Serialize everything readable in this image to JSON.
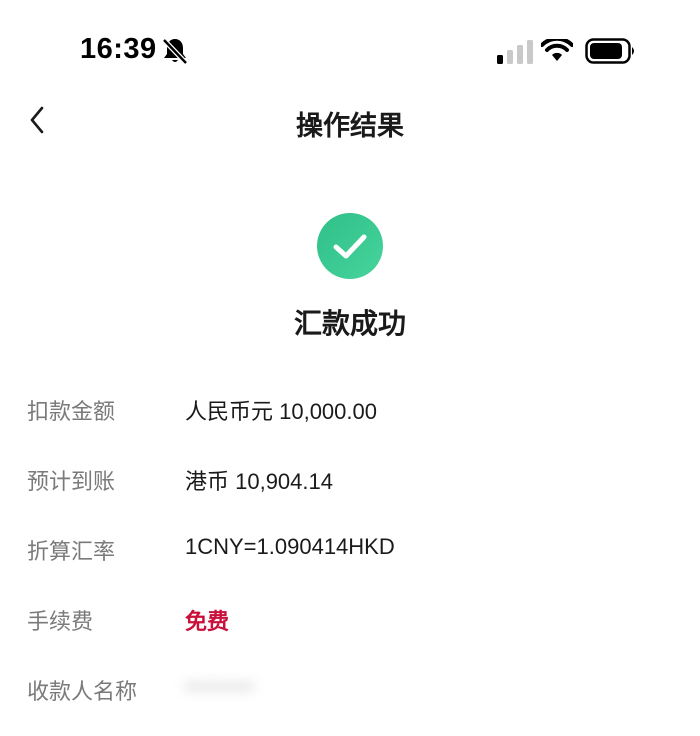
{
  "status_bar": {
    "time": "16:39",
    "icons": [
      "bell-slash-icon",
      "cellular-signal-icon",
      "wifi-icon",
      "battery-icon"
    ]
  },
  "nav": {
    "back_icon": "chevron-left-icon",
    "title": "操作结果"
  },
  "result": {
    "icon": "check-circle-icon",
    "title": "汇款成功"
  },
  "details": [
    {
      "label": "扣款金额",
      "value": "人民币元 10,000.00"
    },
    {
      "label": "预计到账",
      "value": "港币 10,904.14"
    },
    {
      "label": "折算汇率",
      "value": "1CNY=1.090414HKD"
    },
    {
      "label": "手续费",
      "value": "免费"
    },
    {
      "label": "收款人名称",
      "value": "••••••••"
    }
  ],
  "colors": {
    "success": "#3cc88e",
    "fee": "#c8103a",
    "label": "#7a7a7a",
    "text": "#1a1a1a"
  }
}
